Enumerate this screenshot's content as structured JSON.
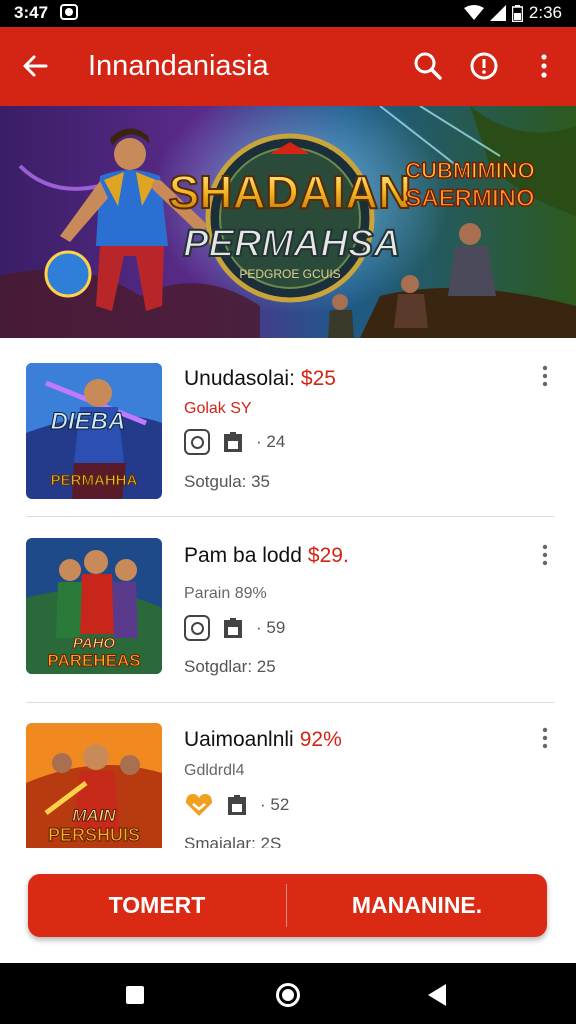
{
  "status_bar": {
    "time": "3:47",
    "right_time": "2:36"
  },
  "app_bar": {
    "title": "Innandaniasia"
  },
  "hero": {
    "title_line1": "SHADAIAN",
    "title_line2": "PERMAHSA",
    "badge_text": "PEDGROE GCUIS",
    "side_title_1": "CUBMIMINO",
    "side_title_2": "SAERMINO"
  },
  "items": [
    {
      "title": "Unudasolai:",
      "price": "$25",
      "subtitle": "Golak SY",
      "subtitle_color": "#d32414",
      "count": "24",
      "footer": "Sotgula: 35",
      "thumb_text_1": "DIEBA",
      "thumb_text_2": "PERMAHHA"
    },
    {
      "title": "Pam ba lodd",
      "price": "$29.",
      "subtitle": "Parain 89%",
      "subtitle_color": "#666666",
      "count": "59",
      "footer": "Sotgdlar: 25",
      "thumb_text_1": "PAHO",
      "thumb_text_2": "PAREHEAS"
    },
    {
      "title": "Uaimoanlnli",
      "price": "92%",
      "subtitle": "Gdldrdl4",
      "subtitle_color": "#666666",
      "count": "52",
      "footer": "Smaialar: 2S",
      "thumb_text_1": "MAIN",
      "thumb_text_2": "PERSHUIS"
    }
  ],
  "buttons": {
    "left": "TOMERT",
    "right": "MANANINE."
  },
  "colors": {
    "primary": "#d32414",
    "accent_orange": "#f0a020"
  }
}
